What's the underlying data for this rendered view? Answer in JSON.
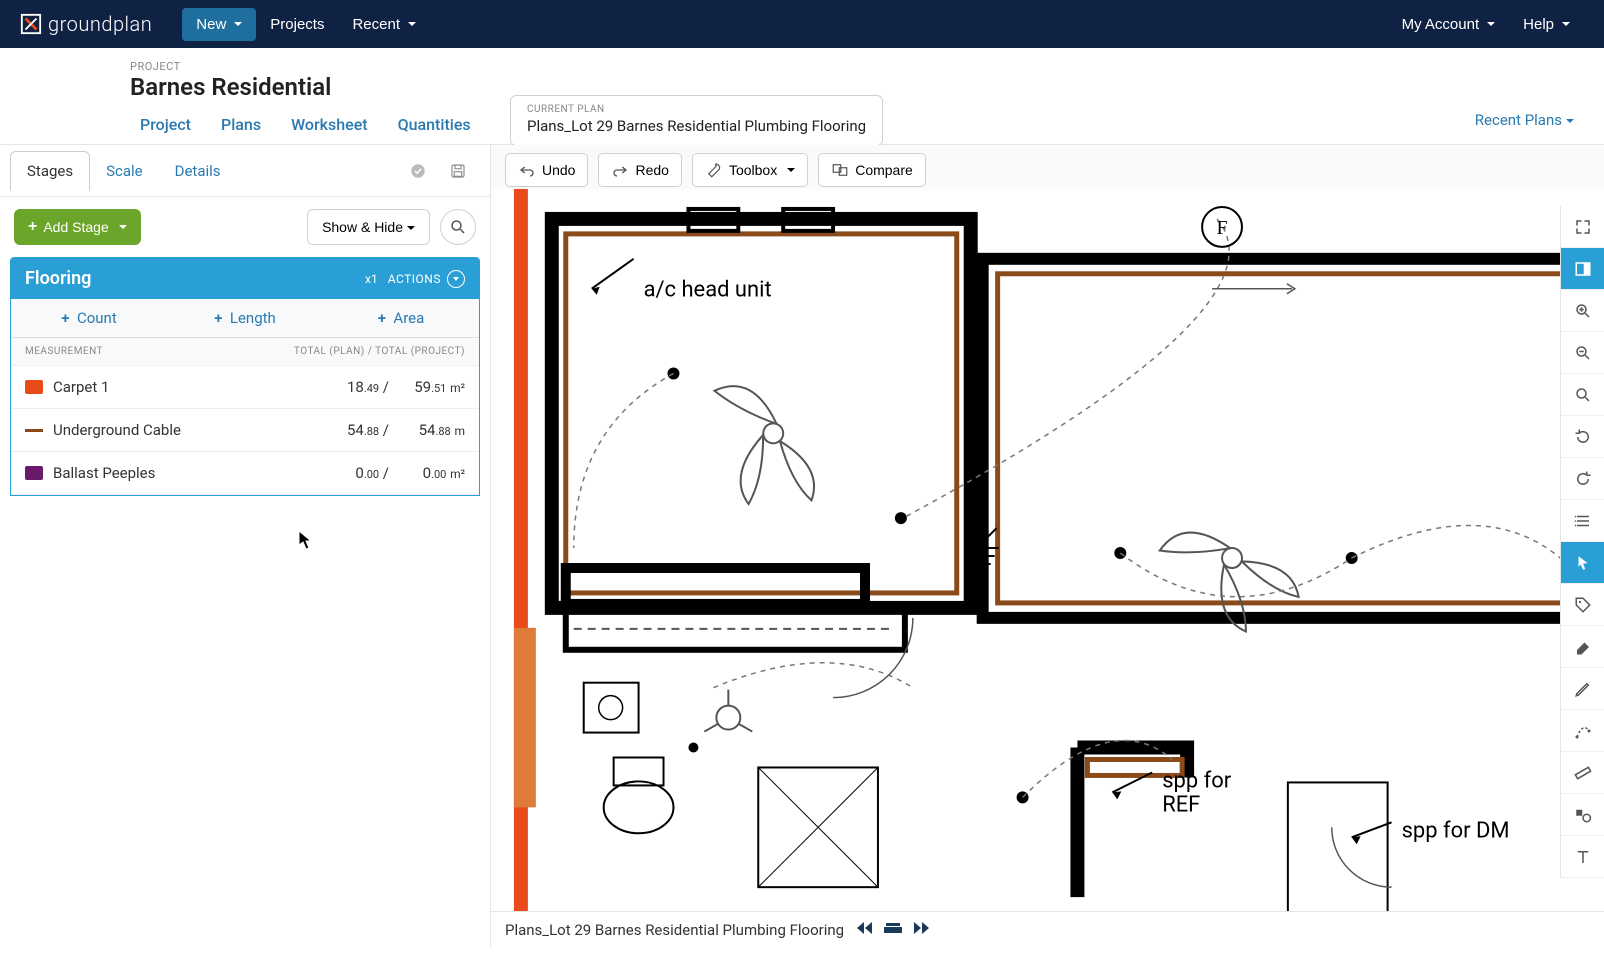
{
  "brand": {
    "name": "groundplan"
  },
  "topnav": {
    "new": "New",
    "projects": "Projects",
    "recent": "Recent",
    "account": "My Account",
    "help": "Help"
  },
  "project": {
    "label": "PROJECT",
    "title": "Barnes Residential"
  },
  "subnav": {
    "project": "Project",
    "plans": "Plans",
    "worksheet": "Worksheet",
    "quantities": "Quantities",
    "recent_plans": "Recent Plans"
  },
  "current_plan": {
    "label": "CURRENT PLAN",
    "name": "Plans_Lot 29 Barnes Residential Plumbing Flooring"
  },
  "left_tabs": {
    "stages": "Stages",
    "scale": "Scale",
    "details": "Details"
  },
  "stage_controls": {
    "add_stage": "Add Stage",
    "show_hide": "Show & Hide"
  },
  "stage": {
    "title": "Flooring",
    "multiplier": "x1",
    "actions": "ACTIONS"
  },
  "meas_tabs": {
    "count": "Count",
    "length": "Length",
    "area": "Area"
  },
  "meas_header": {
    "left": "MEASUREMENT",
    "right": "TOTAL (PLAN) / TOTAL (PROJECT)"
  },
  "measurements": [
    {
      "color": "#e84a1a",
      "type": "block",
      "name": "Carpet 1",
      "plan_int": "18",
      "plan_frac": ".49",
      "sep": " /",
      "proj_int": "59",
      "proj_frac": ".51",
      "unit": "m²"
    },
    {
      "color": "#8a4a1a",
      "type": "line",
      "name": "Underground Cable",
      "plan_int": "54",
      "plan_frac": ".88",
      "sep": " /",
      "proj_int": "54",
      "proj_frac": ".88",
      "unit": "m"
    },
    {
      "color": "#6a1a6a",
      "type": "block",
      "name": "Ballast Peeples",
      "plan_int": "0",
      "plan_frac": ".00",
      "sep": " /",
      "proj_int": "0",
      "proj_frac": ".00",
      "unit": "m²"
    }
  ],
  "toolbar2": {
    "undo": "Undo",
    "redo": "Redo",
    "toolbox": "Toolbox",
    "compare": "Compare"
  },
  "footer": {
    "plan": "Plans_Lot 29 Barnes Residential Plumbing Flooring"
  },
  "floorplan": {
    "labels": {
      "ac": "a/c head unit",
      "ref1": "spp for",
      "ref2": "REF",
      "dm": "spp for DM",
      "f": "F"
    }
  }
}
